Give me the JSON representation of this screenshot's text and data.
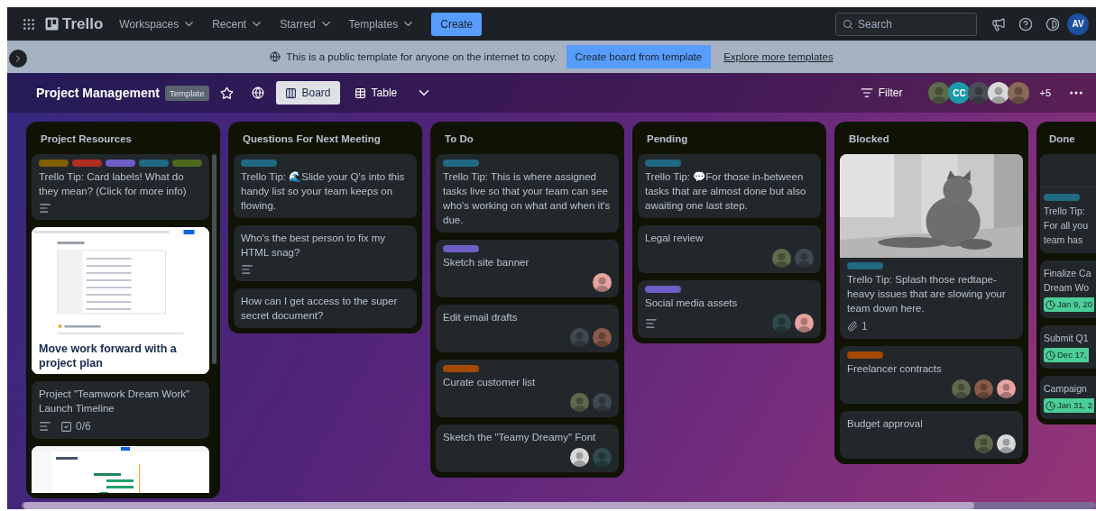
{
  "topbar": {
    "logo": "Trello",
    "nav": [
      "Workspaces",
      "Recent",
      "Starred",
      "Templates"
    ],
    "create": "Create",
    "search": {
      "placeholder": "Search"
    },
    "account": {
      "initials": "AV",
      "color": "#1c4fa0"
    }
  },
  "banner": {
    "message": "This is a public template for anyone on the internet to copy.",
    "button": "Create board from template",
    "link": "Explore more templates"
  },
  "board": {
    "title": "Project Management",
    "badge": "Template",
    "starred": false,
    "views": [
      {
        "label": "Board",
        "selected": true
      },
      {
        "label": "Table",
        "selected": false
      }
    ],
    "filter": "Filter",
    "members": [
      {
        "color": "#5d6b4b"
      },
      {
        "initials": "CC",
        "color": "#1d9aaa"
      },
      {
        "color": "#4a4f57"
      },
      {
        "color": "#d9d9d9"
      },
      {
        "color": "#8a6a5a"
      }
    ],
    "more_members": "+5"
  },
  "lists": [
    {
      "title": "Project Resources",
      "scrollable": true,
      "cards": [
        {
          "kind": "card",
          "labels": [
            {
              "color": "#7f5f01"
            },
            {
              "color": "#ae2e24"
            },
            {
              "color": "#6e5dc6"
            },
            {
              "color": "#206a83"
            },
            {
              "color": "#4c6b1f"
            }
          ],
          "title": "Trello Tip: Card labels! What do they mean? (Click for more info)",
          "description": true
        },
        {
          "kind": "document_cover",
          "title": "Move work forward with a project plan"
        },
        {
          "kind": "card",
          "title": "Project \"Teamwork Dream Work\" Launch Timeline",
          "description": true,
          "checklist": "0/6"
        },
        {
          "kind": "image_card"
        }
      ]
    },
    {
      "title": "Questions For Next Meeting",
      "scrollable": false,
      "cards": [
        {
          "kind": "card",
          "labels": [
            {
              "color": "#206a83"
            }
          ],
          "title": "Trello Tip: 🌊Slide your Q's into this handy list so your team keeps on flowing."
        },
        {
          "kind": "card",
          "title": "Who's the best person to fix my HTML snag?",
          "description": true
        },
        {
          "kind": "card",
          "title": "How can I get access to the super secret document?"
        }
      ]
    },
    {
      "title": "To Do",
      "scrollable": false,
      "cards": [
        {
          "kind": "card",
          "labels": [
            {
              "color": "#206a83"
            }
          ],
          "title": "Trello Tip: This is where assigned tasks live so that your team can see who's working on what and when it's due."
        },
        {
          "kind": "card",
          "labels": [
            {
              "color": "#6e5dc6"
            }
          ],
          "title": "Sketch site banner",
          "members": [
            {
              "color": "#e8a3a0"
            }
          ]
        },
        {
          "kind": "card",
          "title": "Edit email drafts",
          "members": [
            {
              "color": "#3e4a4f"
            },
            {
              "color": "#8a5a4a"
            }
          ]
        },
        {
          "kind": "card",
          "labels": [
            {
              "color": "#a54800"
            }
          ],
          "title": "Curate customer list",
          "members": [
            {
              "color": "#5d6b4b"
            },
            {
              "color": "#3e4a4f"
            }
          ]
        },
        {
          "kind": "card",
          "title": "Sketch the \"Teamy Dreamy\" Font",
          "members": [
            {
              "color": "#d9d9d9"
            },
            {
              "color": "#2f4a4a"
            }
          ]
        }
      ]
    },
    {
      "title": "Pending",
      "scrollable": false,
      "cards": [
        {
          "kind": "card",
          "labels": [
            {
              "color": "#206a83"
            }
          ],
          "title": "Trello Tip: 💬For those in-between tasks that are almost done but also awaiting one last step."
        },
        {
          "kind": "card",
          "title": "Legal review",
          "members": [
            {
              "color": "#5d6b4b"
            },
            {
              "color": "#3e4a4f"
            }
          ]
        },
        {
          "kind": "card",
          "labels": [
            {
              "color": "#6e5dc6"
            }
          ],
          "title": "Social media assets",
          "description": true,
          "members": [
            {
              "color": "#2f4a4a"
            },
            {
              "color": "#e8a3a0"
            }
          ]
        }
      ]
    },
    {
      "title": "Blocked",
      "scrollable": false,
      "cards": [
        {
          "kind": "card",
          "cover": {
            "kind": "picture"
          },
          "labels": [
            {
              "color": "#206a83"
            }
          ],
          "title": "Trello Tip: Splash those redtape-heavy issues that are slowing your team down here.",
          "attachments": "1"
        },
        {
          "kind": "card",
          "labels": [
            {
              "color": "#a54800"
            }
          ],
          "title": "Freelancer contracts",
          "members": [
            {
              "color": "#5d6b4b"
            },
            {
              "color": "#8a5a4a"
            },
            {
              "color": "#e8a3a0"
            }
          ]
        },
        {
          "kind": "card",
          "title": "Budget approval",
          "members": [
            {
              "color": "#5d6b4b"
            },
            {
              "color": "#d9d9d9"
            }
          ]
        }
      ]
    },
    {
      "title": "Done",
      "scrollable": false,
      "cards": [
        {
          "kind": "cut_card",
          "blank_top": true,
          "labels": [
            {
              "color": "#206a83"
            }
          ],
          "lines": [
            "Trello Tip:",
            "For all you",
            "team has"
          ]
        },
        {
          "kind": "cut_card",
          "lines": [
            "Finalize Ca",
            "Dream Wo"
          ],
          "due": "Jan 9, 20"
        },
        {
          "kind": "cut_card",
          "lines": [
            "Submit Q1"
          ],
          "due": "Dec 17,"
        },
        {
          "kind": "cut_card",
          "lines": [
            "Campaign"
          ],
          "due": "Jan 31, 2"
        }
      ]
    }
  ]
}
